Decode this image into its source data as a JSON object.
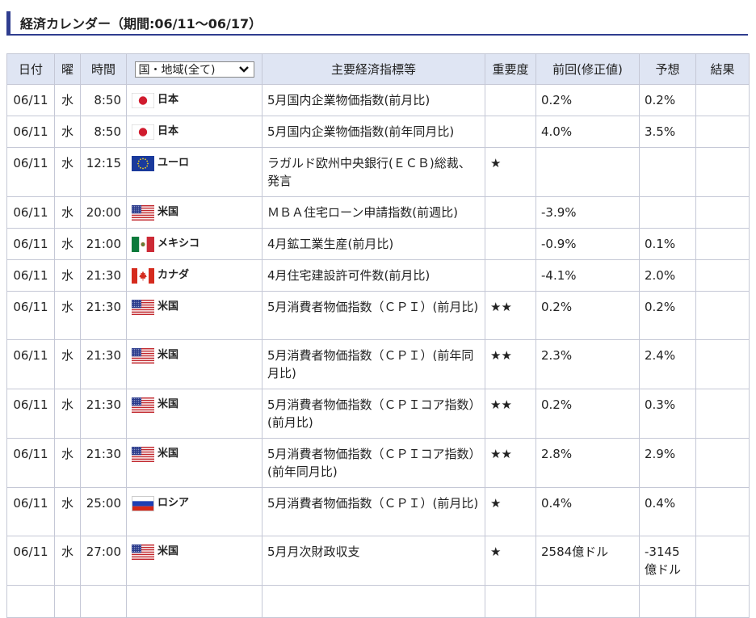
{
  "page": {
    "title": "経済カレンダー（期間:06/11〜06/17）"
  },
  "table": {
    "headers": {
      "date": "日付",
      "day": "曜",
      "time": "時間",
      "country_select": "国・地域(全て)",
      "indicator": "主要経済指標等",
      "importance": "重要度",
      "previous": "前回(修正値)",
      "forecast": "予想",
      "result": "結果"
    },
    "rows": [
      {
        "date": "06/11",
        "day": "水",
        "time": "8:50",
        "flag": "jp-flag",
        "country": "日本",
        "indicator": "5月国内企業物価指数(前月比)",
        "importance": "",
        "previous": "0.2%",
        "forecast": "0.2%",
        "result": ""
      },
      {
        "date": "06/11",
        "day": "水",
        "time": "8:50",
        "flag": "jp-flag",
        "country": "日本",
        "indicator": "5月国内企業物価指数(前年同月比)",
        "importance": "",
        "previous": "4.0%",
        "forecast": "3.5%",
        "result": ""
      },
      {
        "date": "06/11",
        "day": "水",
        "time": "12:15",
        "flag": "eu-flag",
        "country": "ユーロ",
        "indicator": " ラガルド欧州中央銀行(ＥＣＢ)総裁、発言",
        "importance": "★",
        "previous": "",
        "forecast": "",
        "result": ""
      },
      {
        "date": "06/11",
        "day": "水",
        "time": "20:00",
        "flag": "us-flag",
        "country": "米国",
        "indicator": " ＭＢＡ住宅ローン申請指数(前週比)",
        "importance": "",
        "previous": "-3.9%",
        "forecast": "",
        "result": ""
      },
      {
        "date": "06/11",
        "day": "水",
        "time": "21:00",
        "flag": "mx-flag",
        "country": "メキシコ",
        "indicator": "4月鉱工業生産(前月比)",
        "importance": "",
        "previous": "-0.9%",
        "forecast": "0.1%",
        "result": ""
      },
      {
        "date": "06/11",
        "day": "水",
        "time": "21:30",
        "flag": "ca-flag",
        "country": "カナダ",
        "indicator": "4月住宅建設許可件数(前月比)",
        "importance": "",
        "previous": "-4.1%",
        "forecast": "2.0%",
        "result": ""
      },
      {
        "date": "06/11",
        "day": "水",
        "time": "21:30",
        "flag": "us-flag",
        "country": "米国",
        "indicator": "5月消費者物価指数（ＣＰＩ）(前月比)",
        "importance": "★★",
        "previous": "0.2%",
        "forecast": "0.2%",
        "result": ""
      },
      {
        "date": "06/11",
        "day": "水",
        "time": "21:30",
        "flag": "us-flag",
        "country": "米国",
        "indicator": "5月消費者物価指数（ＣＰＩ）(前年同月比)",
        "importance": "★★",
        "previous": "2.3%",
        "forecast": "2.4%",
        "result": ""
      },
      {
        "date": "06/11",
        "day": "水",
        "time": "21:30",
        "flag": "us-flag",
        "country": "米国",
        "indicator": "5月消費者物価指数（ＣＰＩコア指数）(前月比)",
        "importance": "★★",
        "previous": "0.2%",
        "forecast": "0.3%",
        "result": ""
      },
      {
        "date": "06/11",
        "day": "水",
        "time": "21:30",
        "flag": "us-flag",
        "country": "米国",
        "indicator": "5月消費者物価指数（ＣＰＩコア指数）(前年同月比)",
        "importance": "★★",
        "previous": "2.8%",
        "forecast": "2.9%",
        "result": ""
      },
      {
        "date": "06/11",
        "day": "水",
        "time": "25:00",
        "flag": "ru-flag",
        "country": "ロシア",
        "indicator": "5月消費者物価指数（ＣＰＩ）(前月比)",
        "importance": "★",
        "previous": "0.4%",
        "forecast": "0.4%",
        "result": ""
      },
      {
        "date": "06/11",
        "day": "水",
        "time": "27:00",
        "flag": "us-flag",
        "country": "米国",
        "indicator": "5月月次財政収支",
        "importance": "★",
        "previous": "2584億ドル",
        "forecast": "-3145億ドル",
        "result": ""
      }
    ]
  },
  "colors": {
    "accent": "#2f3d8f",
    "header_bg": "#dfe5f3",
    "border": "#c5c8d6"
  }
}
